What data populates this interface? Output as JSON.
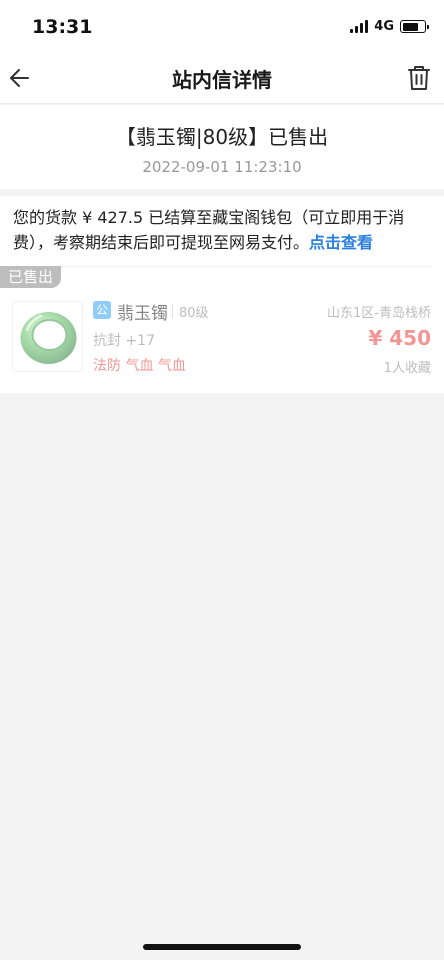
{
  "status": {
    "time": "13:31",
    "network": "4G",
    "battery_level": 0.75
  },
  "nav": {
    "title": "站内信详情",
    "back_icon": "arrow-left-icon",
    "delete_icon": "trash-icon"
  },
  "message": {
    "title": "【翡玉镯|80级】已售出",
    "time": "2022-09-01 11:23:10",
    "body_text": "您的货款 ¥ 427.5 已结算至藏宝阁钱包（可立即用于消费），考察期结束后即可提现至网易支付。",
    "link_text": "点击查看"
  },
  "item": {
    "sold_tag": "已售出",
    "public_badge": "公",
    "name": "翡玉镯",
    "level": "80级",
    "server": "山东1区-青岛栈桥",
    "stat": "抗封 +17",
    "price": "¥ 450",
    "attributes": "法防 气血 气血",
    "favorites": "1人收藏",
    "thumb_icon": "jade-bracelet-icon"
  },
  "colors": {
    "accent_link": "#2a7fe0",
    "price_red": "#e8413c",
    "badge_blue": "#36a3f7"
  }
}
